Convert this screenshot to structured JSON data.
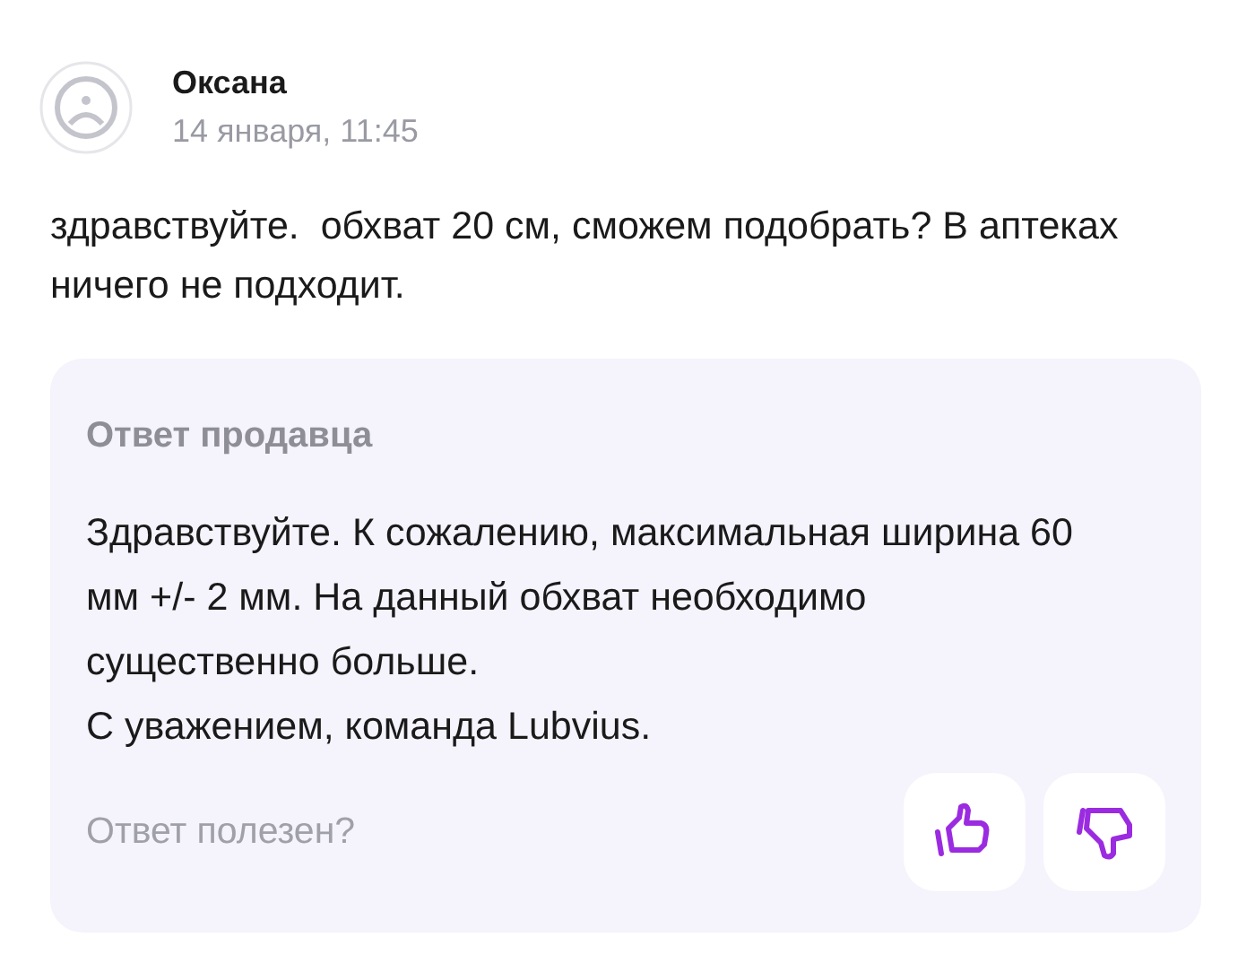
{
  "review": {
    "author": "Оксана",
    "date": "14 января, 11:45",
    "text": "здравствуйте.  обхват 20 см, сможем подобрать? В аптеках ничего не подходит."
  },
  "seller_answer": {
    "title": "Ответ продавца",
    "lines": [
      "Здравствуйте. К сожалению, максимальная ширина 60 мм +/- 2 мм. На данный обхват необходимо существенно больше.",
      "С уважением, команда Lubvius."
    ],
    "helpful_prompt": "Ответ полезен?"
  }
}
